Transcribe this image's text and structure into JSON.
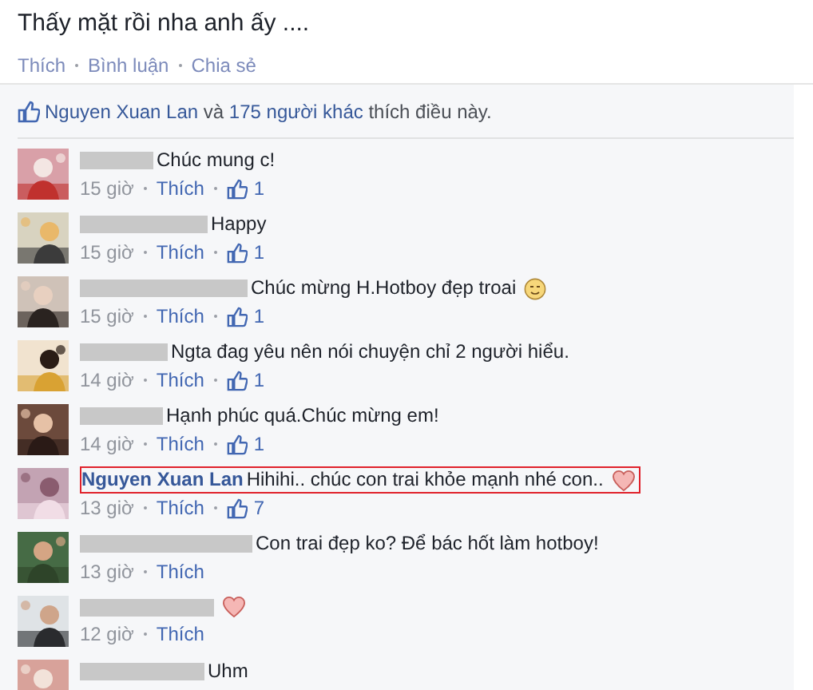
{
  "post": {
    "text": "Thấy mặt rồi nha anh ấy ....",
    "actions": [
      "Thích",
      "Bình luận",
      "Chia sẻ"
    ]
  },
  "likes_summary": {
    "first_liker": "Nguyen Xuan Lan",
    "joiner": " và ",
    "others": "175 người khác",
    "suffix": " thích điều này."
  },
  "comments": [
    {
      "name_redacted": true,
      "text": "Chúc mung c!",
      "time": "15 giờ",
      "like_label": "Thích",
      "like_count": "1"
    },
    {
      "name_redacted": true,
      "text": "Happy",
      "time": "15 giờ",
      "like_label": "Thích",
      "like_count": "1"
    },
    {
      "name_redacted": true,
      "text": "Chúc mừng H.Hotboy đẹp troai",
      "smiley": true,
      "time": "15 giờ",
      "like_label": "Thích",
      "like_count": "1"
    },
    {
      "name_redacted": true,
      "text": "Ngta đag yêu nên nói chuyện chỉ 2 người hiểu.",
      "time": "14 giờ",
      "like_label": "Thích",
      "like_count": "1"
    },
    {
      "name_redacted": true,
      "text": "Hạnh phúc quá.Chúc mừng em!",
      "time": "14 giờ",
      "like_label": "Thích",
      "like_count": "1"
    },
    {
      "name_redacted": false,
      "name": "Nguyen Xuan Lan",
      "text": "Hihihi.. chúc con trai khỏe mạnh nhé con..",
      "heart": true,
      "highlighted": true,
      "time": "13 giờ",
      "like_label": "Thích",
      "like_count": "7"
    },
    {
      "name_redacted": true,
      "text": "Con trai đẹp ko? Để bác hốt làm hotboy!",
      "time": "13 giờ",
      "like_label": "Thích"
    },
    {
      "name_redacted": true,
      "heart": true,
      "time": "12 giờ",
      "like_label": "Thích"
    },
    {
      "name_redacted": true,
      "text": "Uhm"
    }
  ]
}
